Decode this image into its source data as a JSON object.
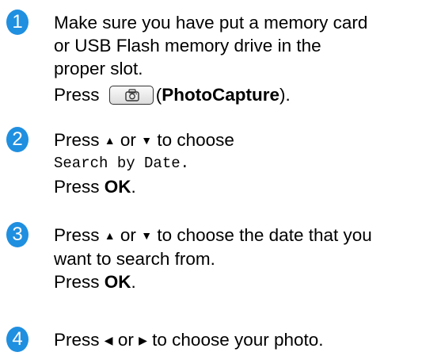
{
  "colors": {
    "badge": "#1f8fe0",
    "text": "#000000"
  },
  "steps": [
    {
      "number": "1",
      "line1": "Make sure you have put a memory card",
      "line2": "or USB Flash memory drive in the",
      "line3": "proper slot.",
      "press": "Press",
      "button_icon": "camera-icon",
      "paren_open": "(",
      "button_label": "PhotoCapture",
      "paren_close": ")."
    },
    {
      "number": "2",
      "press": "Press",
      "or": "or",
      "tail": "to choose",
      "display_text": "Search by Date.",
      "press2": "Press",
      "ok": "OK",
      "period": "."
    },
    {
      "number": "3",
      "press": "Press",
      "or": "or",
      "tail": "to choose the date that you",
      "line2": "want to search from.",
      "press2": "Press",
      "ok": "OK",
      "period": "."
    },
    {
      "number": "4",
      "press": "Press",
      "or": "or",
      "tail": "to choose your photo."
    }
  ],
  "glyphs": {
    "up": "▲",
    "down": "▼",
    "left": "◀",
    "right": "▶"
  }
}
